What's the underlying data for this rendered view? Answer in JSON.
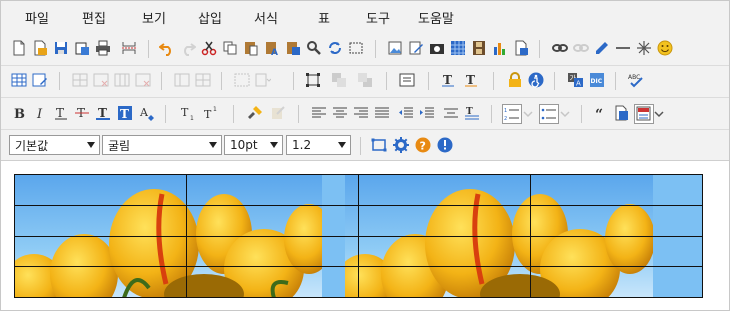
{
  "menu": [
    "파일",
    "편집",
    "보기",
    "삽입",
    "서식",
    "표",
    "도구",
    "도움말"
  ],
  "font_family": {
    "value": "기본값"
  },
  "font_face": {
    "value": "굴림"
  },
  "font_size": {
    "value": "10pt"
  },
  "line_height": {
    "value": "1.2"
  },
  "colors": {
    "chrome": "#f2f2f2",
    "accent_blue": "#2c69c7",
    "accent_orange": "#e88a12",
    "sky": "#7fbff2",
    "tulip": "#f3b316"
  }
}
